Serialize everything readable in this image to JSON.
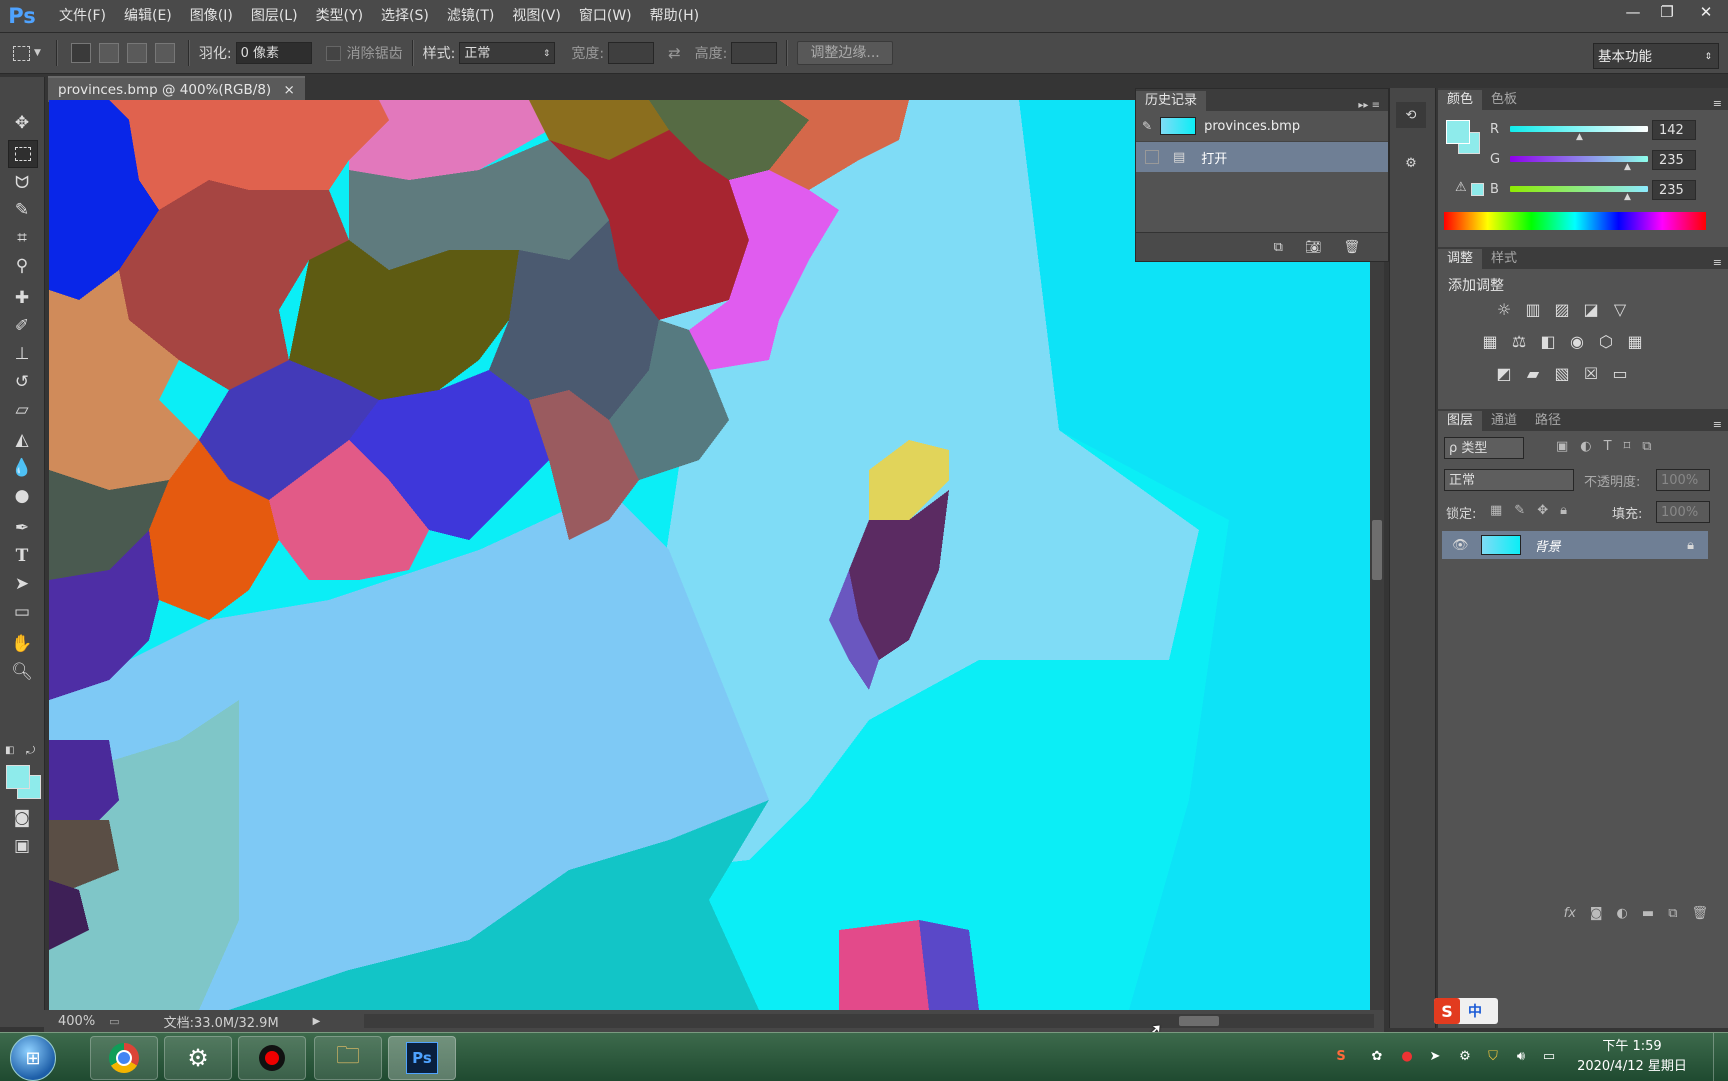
{
  "app": {
    "logo": "Ps"
  },
  "menu": [
    "文件(F)",
    "编辑(E)",
    "图像(I)",
    "图层(L)",
    "类型(Y)",
    "选择(S)",
    "滤镜(T)",
    "视图(V)",
    "窗口(W)",
    "帮助(H)"
  ],
  "window_controls": {
    "minimize": "—",
    "restore": "❐",
    "close": "✕"
  },
  "options": {
    "feather_label": "羽化:",
    "feather_value": "0 像素",
    "antialias_label": "消除锯齿",
    "style_label": "样式:",
    "style_value": "正常",
    "width_label": "宽度:",
    "height_label": "高度:",
    "refine_edge": "调整边缘...",
    "workspace": "基本功能"
  },
  "document": {
    "tab_title": "provinces.bmp @ 400%(RGB/8)",
    "close": "×",
    "zoom": "400%",
    "doc_size": "文档:33.0M/32.9M"
  },
  "history": {
    "tab": "历史记录",
    "snapshot": "provinces.bmp",
    "steps": [
      "打开"
    ]
  },
  "color_panel": {
    "tabs": [
      "颜色",
      "色板"
    ],
    "r_label": "R",
    "g_label": "G",
    "b_label": "B",
    "r": "142",
    "g": "235",
    "b": "235",
    "fg_color": "#8eebeb",
    "bg_color": "#8eebeb"
  },
  "adjust_panel": {
    "tabs": [
      "调整",
      "样式"
    ],
    "heading": "添加调整"
  },
  "layers_panel": {
    "tabs": [
      "图层",
      "通道",
      "路径"
    ],
    "filter": "ρ 类型",
    "blend_mode": "正常",
    "opacity_label": "不透明度:",
    "opacity_value": "100%",
    "lock_label": "锁定:",
    "fill_label": "填充:",
    "fill_value": "100%",
    "layer_name": "背景"
  },
  "ime": {
    "logo": "S",
    "mode": "中"
  },
  "clock": {
    "time": "下午 1:59",
    "date": "2020/4/12 星期日"
  },
  "map_colors": {
    "sea_cyan": "#0beef6",
    "shallow_blue": "#7ec9f5",
    "sky_blue": "#7fdcf6",
    "taiwan": "#5b2b62"
  }
}
